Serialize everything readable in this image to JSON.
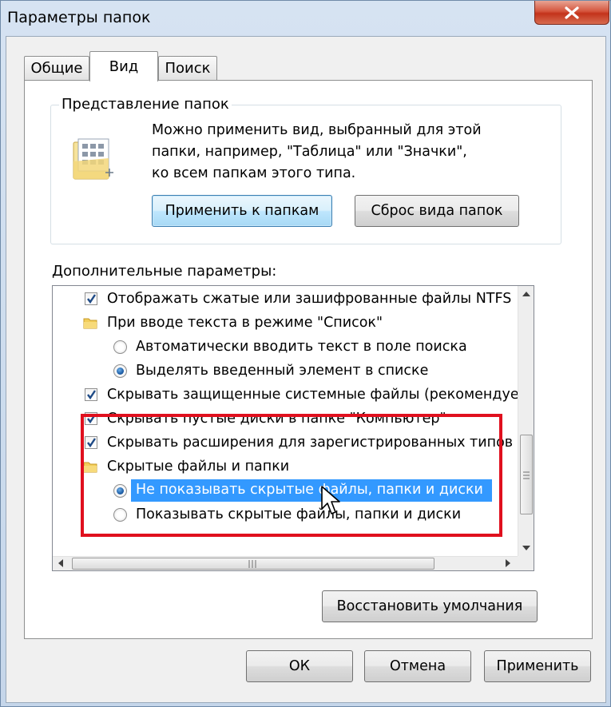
{
  "window": {
    "title": "Параметры папок",
    "close_icon": "close-icon"
  },
  "tabs": [
    {
      "label": "Общие",
      "active": false
    },
    {
      "label": "Вид",
      "active": true
    },
    {
      "label": "Поиск",
      "active": false
    }
  ],
  "folder_views": {
    "legend": "Представление папок",
    "description_lines": [
      "Можно применить вид, выбранный для этой",
      "папки, например, \"Таблица\" или \"Значки\",",
      "ко всем папкам этого типа."
    ],
    "apply_button": "Применить к папкам",
    "reset_button": "Сброс вида папок"
  },
  "advanced": {
    "label": "Дополнительные параметры:",
    "items": [
      {
        "kind": "checkbox",
        "checked": true,
        "label": "Отображать сжатые или зашифрованные файлы NTFS"
      },
      {
        "kind": "folder",
        "label": "При вводе текста в режиме \"Список\""
      },
      {
        "kind": "radio",
        "checked": false,
        "label": "Автоматически вводить текст в поле поиска"
      },
      {
        "kind": "radio",
        "checked": true,
        "label": "Выделять введенный элемент в списке"
      },
      {
        "kind": "checkbox",
        "checked": true,
        "label": "Скрывать защищенные системные файлы (рекомендуется)"
      },
      {
        "kind": "checkbox",
        "checked": true,
        "label": "Скрывать пустые диски в папке \"Компьютер\""
      },
      {
        "kind": "checkbox",
        "checked": true,
        "label": "Скрывать расширения для зарегистрированных типов файлов"
      },
      {
        "kind": "folder",
        "label": "Скрытые файлы и папки"
      },
      {
        "kind": "radio",
        "checked": true,
        "selected": true,
        "label": "Не показывать скрытые файлы, папки и диски"
      },
      {
        "kind": "radio",
        "checked": false,
        "label": "Показывать скрытые файлы, папки и диски"
      }
    ],
    "restore_button": "Восстановить умолчания"
  },
  "footer": {
    "ok": "ОК",
    "cancel": "Отмена",
    "apply": "Применить"
  },
  "colors": {
    "highlight": "#3399ff",
    "annotation_box": "#e0101e",
    "close_button": "#c3331b"
  }
}
